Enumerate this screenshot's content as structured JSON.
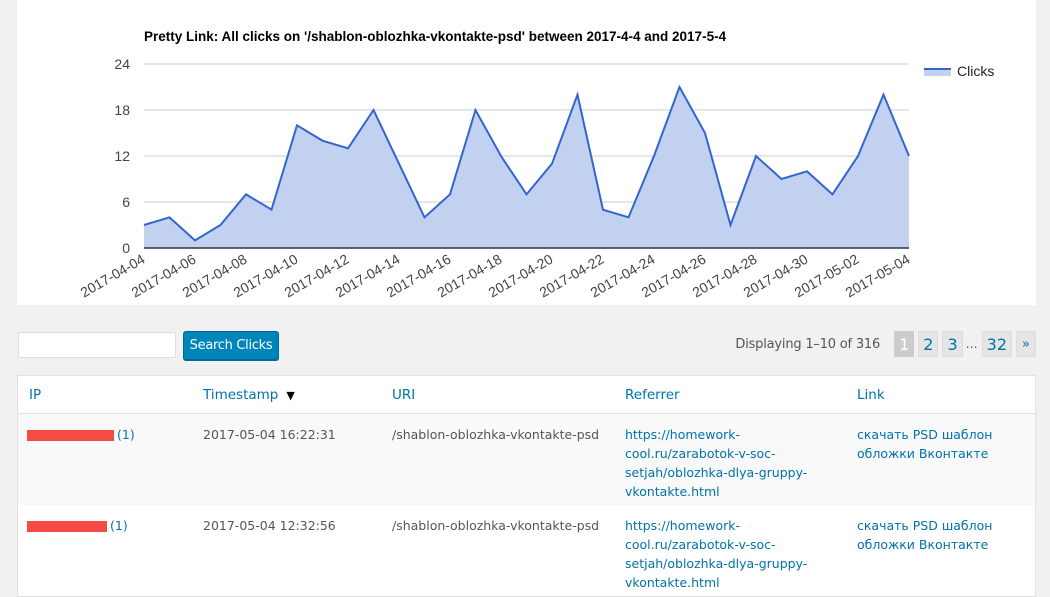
{
  "chart": {
    "legend_label": "Clicks",
    "colors": {
      "line": "#3366cc",
      "fill": "#c2d1f0"
    }
  },
  "chart_data": {
    "type": "area",
    "title": "Pretty Link: All clicks on '/shablon-oblozhka-vkontakte-psd' between 2017-4-4 and 2017-5-4",
    "xlabel": "",
    "ylabel": "",
    "ylim": [
      0,
      24
    ],
    "yticks": [
      "0",
      "6",
      "12",
      "18",
      "24"
    ],
    "grid": true,
    "legend": "top-right",
    "x": [
      "2017-04-04",
      "2017-04-05",
      "2017-04-06",
      "2017-04-07",
      "2017-04-08",
      "2017-04-09",
      "2017-04-10",
      "2017-04-11",
      "2017-04-12",
      "2017-04-13",
      "2017-04-14",
      "2017-04-15",
      "2017-04-16",
      "2017-04-17",
      "2017-04-18",
      "2017-04-19",
      "2017-04-20",
      "2017-04-21",
      "2017-04-22",
      "2017-04-23",
      "2017-04-24",
      "2017-04-25",
      "2017-04-26",
      "2017-04-27",
      "2017-04-28",
      "2017-04-29",
      "2017-04-30",
      "2017-05-01",
      "2017-05-02",
      "2017-05-03",
      "2017-05-04"
    ],
    "xticks": [
      "2017-04-04",
      "2017-04-06",
      "2017-04-08",
      "2017-04-10",
      "2017-04-12",
      "2017-04-14",
      "2017-04-16",
      "2017-04-18",
      "2017-04-20",
      "2017-04-22",
      "2017-04-24",
      "2017-04-26",
      "2017-04-28",
      "2017-04-30",
      "2017-05-02",
      "2017-05-04"
    ],
    "series": [
      {
        "name": "Clicks",
        "values": [
          3,
          4,
          1,
          3,
          7,
          5,
          16,
          14,
          13,
          18,
          11,
          4,
          7,
          18,
          12,
          7,
          11,
          20,
          5,
          4,
          12,
          21,
          15,
          3,
          12,
          9,
          10,
          7,
          12,
          20,
          12
        ]
      }
    ]
  },
  "search": {
    "value": "",
    "button_label": "Search Clicks"
  },
  "pagination": {
    "display_text": "Displaying 1–10 of 316",
    "pages": [
      "1",
      "2",
      "3"
    ],
    "ellipsis": "…",
    "last_page": "32",
    "next_label": "»",
    "current": "1"
  },
  "table": {
    "columns": {
      "ip": "IP",
      "timestamp": "Timestamp",
      "sort_indicator": "▼",
      "uri": "URI",
      "referrer": "Referrer",
      "link": "Link"
    },
    "colors": {
      "redaction": "#f44b45"
    },
    "rows": [
      {
        "ip_count": "(1)",
        "timestamp": "2017-05-04 16:22:31",
        "uri": "/shablon-oblozhka-vkontakte-psd",
        "referrer_lines": [
          "https://homework-",
          "cool.ru/zarabotok-v-soc-",
          "setjah/oblozhka-dlya-gruppy-",
          "vkontakte.html"
        ],
        "link_lines": [
          "скачать PSD шаблон",
          "обложки Вконтакте"
        ]
      },
      {
        "ip_count": "(1)",
        "timestamp": "2017-05-04 12:32:56",
        "uri": "/shablon-oblozhka-vkontakte-psd",
        "referrer_lines": [
          "https://homework-",
          "cool.ru/zarabotok-v-soc-",
          "setjah/oblozhka-dlya-gruppy-",
          "vkontakte.html"
        ],
        "link_lines": [
          "скачать PSD шаблон",
          "обложки Вконтакте"
        ]
      }
    ]
  }
}
